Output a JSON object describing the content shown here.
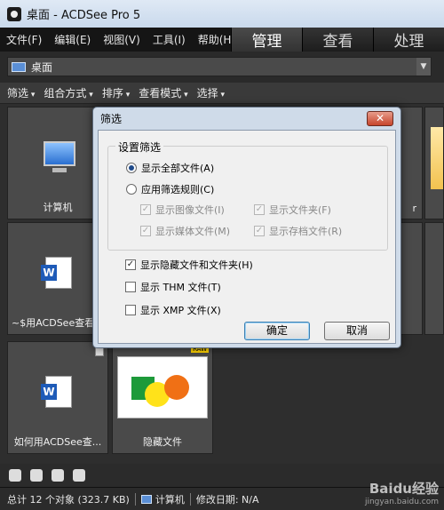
{
  "window": {
    "title": "桌面 - ACDSee Pro 5"
  },
  "menu": [
    "文件(F)",
    "编辑(E)",
    "视图(V)",
    "工具(I)",
    "帮助(H)"
  ],
  "mode_tabs": [
    "管理",
    "查看",
    "处理"
  ],
  "path": {
    "value": "桌面"
  },
  "filterbar": [
    "筛选",
    "组合方式",
    "排序",
    "查看模式",
    "选择"
  ],
  "thumbnails": [
    {
      "label": "计算机",
      "icon": "computer-icon"
    },
    {
      "label": "~$用ACDSee查看",
      "icon": "word-doc-icon"
    },
    {
      "label": "如何用ACDSee查...",
      "icon": "word-doc-icon"
    },
    {
      "label": "隐藏文件",
      "icon": "image-icon"
    }
  ],
  "partial_label": "r",
  "dialog": {
    "title": "筛选",
    "close": "✕",
    "group_title": "设置筛选",
    "radio_all": "显示全部文件(A)",
    "radio_rules": "应用筛选规则(C)",
    "opt_images": "显示图像文件(I)",
    "opt_folders": "显示文件夹(F)",
    "opt_media": "显示媒体文件(M)",
    "opt_archives": "显示存档文件(R)",
    "opt_hidden": "显示隐藏文件和文件夹(H)",
    "opt_thm": "显示 THM 文件(T)",
    "opt_xmp": "显示 XMP 文件(X)",
    "ok": "确定",
    "cancel": "取消"
  },
  "status": {
    "total": "总计 12 个对象 (323.7 KB)",
    "location": "计算机",
    "modified": "修改日期: N/A"
  },
  "watermark": {
    "brand": "Baidu经验",
    "url": "jingyan.baidu.com"
  }
}
